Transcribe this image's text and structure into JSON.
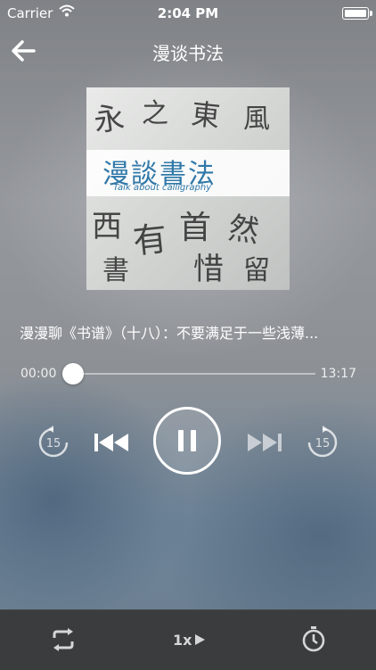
{
  "status_bar": {
    "carrier": "Carrier",
    "time": "2:04 PM",
    "battery": ""
  },
  "nav": {
    "title": "漫谈书法"
  },
  "cover": {
    "title": "漫談書法",
    "subtitle": "Talk about calligraphy"
  },
  "track": {
    "title": "漫漫聊《书谱》（十八）：不要满足于一些浅薄..."
  },
  "progress": {
    "elapsed": "00:00",
    "duration": "13:17",
    "fraction": 0.0
  },
  "controls": {
    "rewind_seconds": "15",
    "forward_seconds": "15",
    "state": "playing"
  },
  "bottom_bar": {
    "playback_rate": "1x"
  },
  "colors": {
    "accent": "#ffffff",
    "bottom_bar": "#3a3c3e",
    "cover_title": "#2f78a8"
  }
}
